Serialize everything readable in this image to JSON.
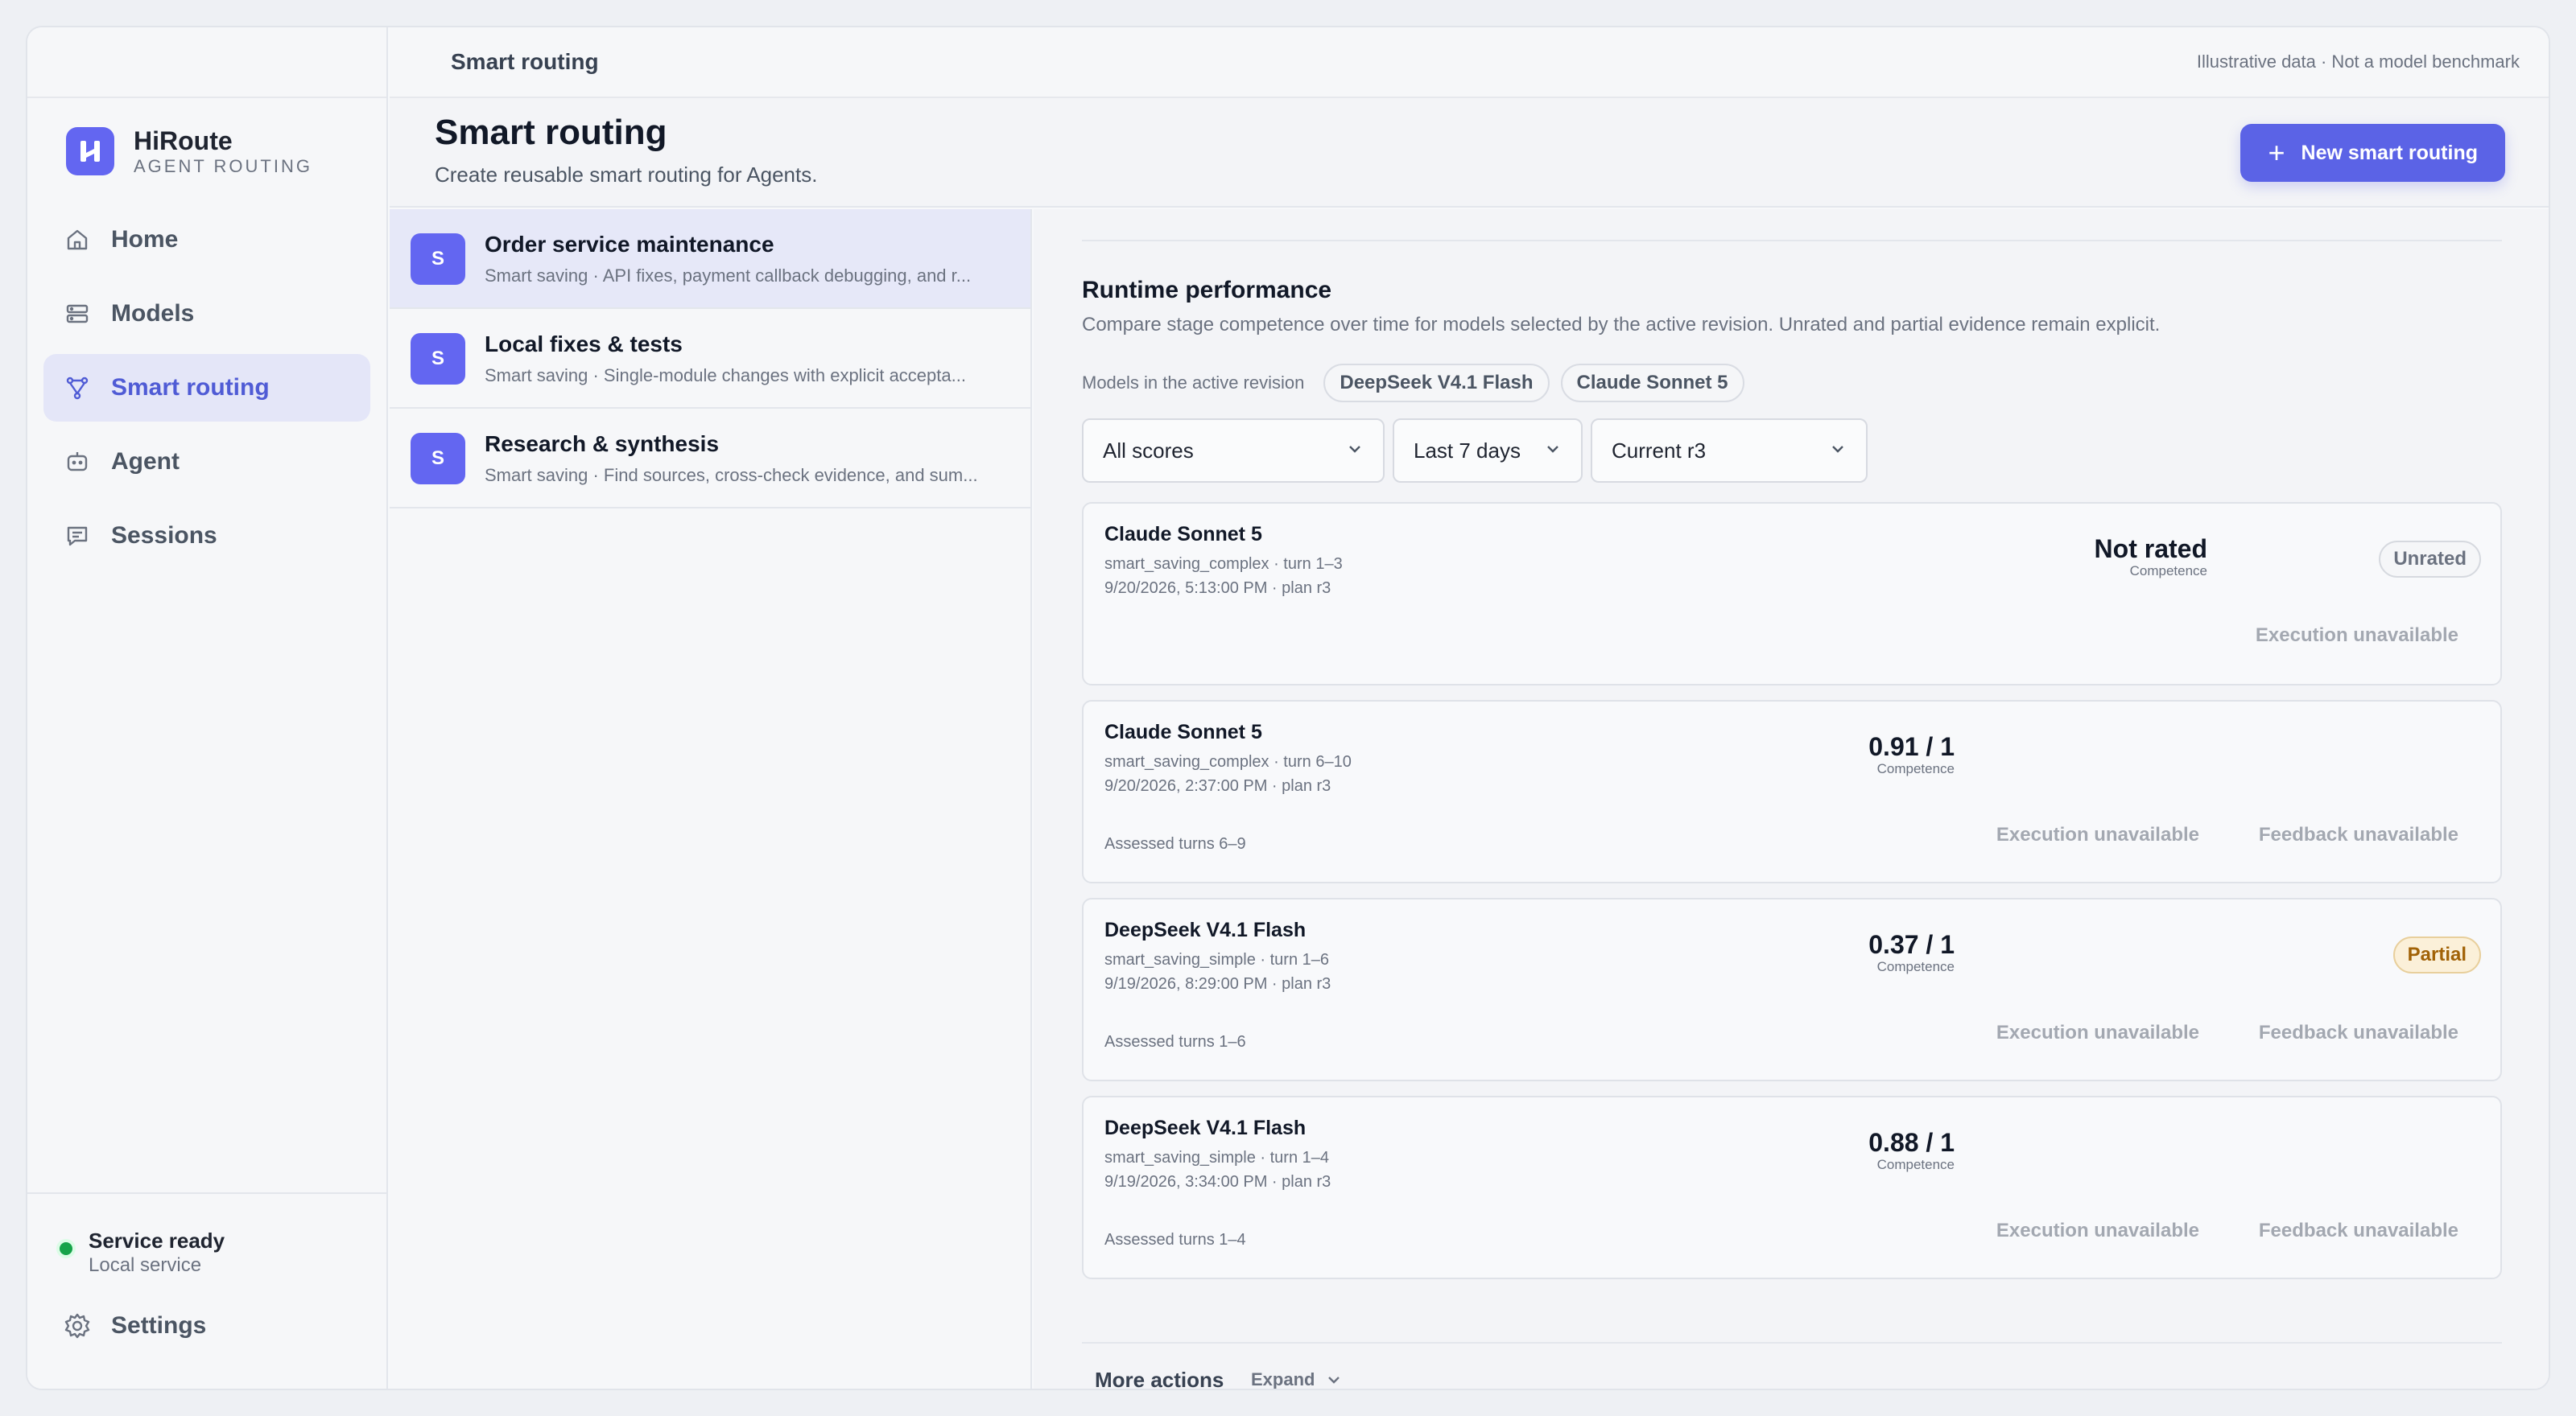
{
  "topbar": {
    "title": "Smart routing",
    "note": "Illustrative data · Not a model benchmark"
  },
  "brand": {
    "name": "HiRoute",
    "subtitle": "AGENT ROUTING",
    "logo_icon": "h-logo-icon"
  },
  "nav": [
    {
      "label": "Home",
      "icon": "home-icon"
    },
    {
      "label": "Models",
      "icon": "server-icon"
    },
    {
      "label": "Smart routing",
      "icon": "routing-icon",
      "active": true
    },
    {
      "label": "Agent",
      "icon": "bot-icon"
    },
    {
      "label": "Sessions",
      "icon": "chat-icon"
    }
  ],
  "status": {
    "title": "Service ready",
    "subtitle": "Local service",
    "color": "#16a34a"
  },
  "settings_label": "Settings",
  "header": {
    "title": "Smart routing",
    "subtitle": "Create reusable smart routing for Agents.",
    "new_button": "New smart routing",
    "accent": "#5b63e6"
  },
  "routings": [
    {
      "avatar": "S",
      "title": "Order service maintenance",
      "desc": "Smart saving · API fixes, payment callback debugging, and r...",
      "active": true
    },
    {
      "avatar": "S",
      "title": "Local fixes & tests",
      "desc": "Smart saving · Single-module changes with explicit accepta..."
    },
    {
      "avatar": "S",
      "title": "Research & synthesis",
      "desc": "Smart saving · Find sources, cross-check evidence, and sum..."
    }
  ],
  "performance": {
    "title": "Runtime performance",
    "subtitle": "Compare stage competence over time for models selected by the active revision. Unrated and partial evidence remain explicit.",
    "models_label": "Models in the active revision",
    "models": [
      "DeepSeek V4.1 Flash",
      "Claude Sonnet 5"
    ],
    "filters": {
      "score": "All scores",
      "range": "Last 7 days",
      "revision": "Current r3"
    },
    "cards": [
      {
        "model": "Claude Sonnet 5",
        "meta1": "smart_saving_complex · turn 1–3",
        "meta2": "9/20/2026, 5:13:00 PM · plan r3",
        "score": "Not rated",
        "score_label": "Competence",
        "badge": "Unrated",
        "assessed": "",
        "execution": "Execution unavailable",
        "feedback": ""
      },
      {
        "model": "Claude Sonnet 5",
        "meta1": "smart_saving_complex · turn 6–10",
        "meta2": "9/20/2026, 2:37:00 PM · plan r3",
        "score": "0.91 / 1",
        "score_label": "Competence",
        "badge": "",
        "assessed": "Assessed turns 6–9",
        "execution": "Execution unavailable",
        "feedback": "Feedback unavailable"
      },
      {
        "model": "DeepSeek V4.1 Flash",
        "meta1": "smart_saving_simple · turn 1–6",
        "meta2": "9/19/2026, 8:29:00 PM · plan r3",
        "score": "0.37 / 1",
        "score_label": "Competence",
        "badge": "Partial",
        "assessed": "Assessed turns 1–6",
        "execution": "Execution unavailable",
        "feedback": "Feedback unavailable"
      },
      {
        "model": "DeepSeek V4.1 Flash",
        "meta1": "smart_saving_simple · turn 1–4",
        "meta2": "9/19/2026, 3:34:00 PM · plan r3",
        "score": "0.88 / 1",
        "score_label": "Competence",
        "badge": "",
        "assessed": "Assessed turns 1–4",
        "execution": "Execution unavailable",
        "feedback": "Feedback unavailable"
      }
    ],
    "more_actions": "More actions",
    "expand": "Expand"
  }
}
